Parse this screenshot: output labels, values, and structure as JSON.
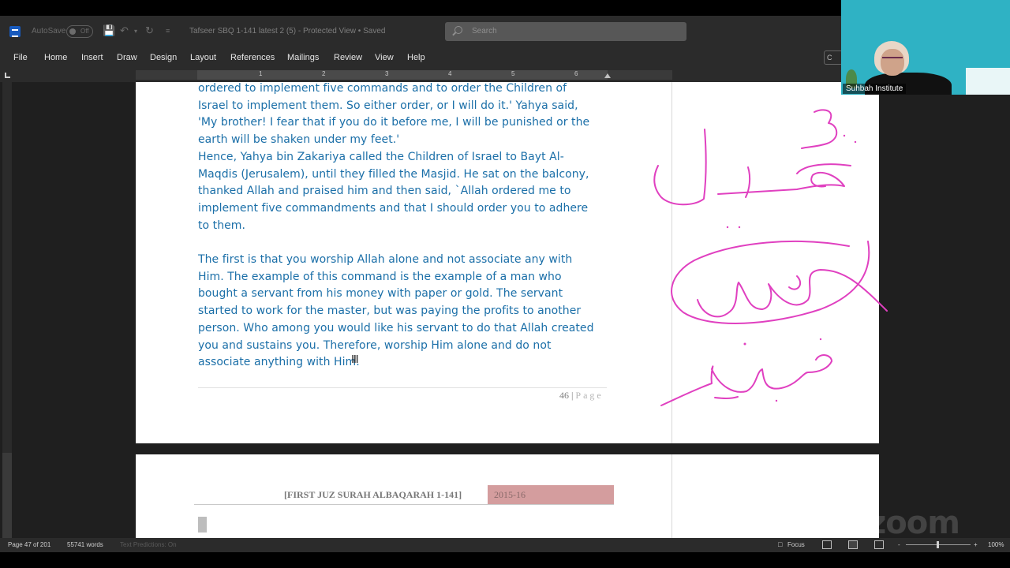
{
  "titlebar": {
    "autosave_label": "AutoSave",
    "autosave_state": "Off",
    "document_title": "Tafseer SBQ 1-141 latest 2 (5)  -  Protected View • Saved",
    "search_placeholder": "Search"
  },
  "menu": {
    "file": "File",
    "home": "Home",
    "insert": "Insert",
    "draw": "Draw",
    "design": "Design",
    "layout": "Layout",
    "references": "References",
    "mailings": "Mailings",
    "review": "Review",
    "view": "View",
    "help": "Help",
    "comments": "C"
  },
  "ruler": {
    "numbers": [
      "1",
      "2",
      "3",
      "4",
      "5",
      "6"
    ]
  },
  "document": {
    "paragraph1": [
      "ordered to implement five commands and to order the Children of",
      "Israel to implement them. So either order, or I will do it.' Yahya said,",
      "'My brother! I fear that if you do it before me, I will be punished or the",
      "earth will be shaken under my feet.'",
      "Hence, Yahya bin Zakariya called the Children of Israel to Bayt Al-",
      "Maqdis (Jerusalem), until they filled the Masjid. He sat on the balcony,",
      "thanked Allah and praised him and then said, `Allah ordered me to",
      "implement five commandments and that I should order you to adhere",
      "to them."
    ],
    "paragraph2": [
      " The first is that you worship Allah alone and not associate any with",
      "Him. The example of this command is the example of a man who",
      "bought a servant from his money with paper or gold. The servant",
      "started to work for the master, but was paying the profits to another",
      "person. Who among you would like his servant to do that Allah created",
      "you and sustains you. Therefore, worship Him alone and do not",
      "associate anything with Him."
    ],
    "page_number": "46",
    "page_separator": " | ",
    "page_label": "Page",
    "next_header_title": "[FIRST JUZ SURAH ALBAQARAH 1-141]",
    "next_header_year": "2015-16"
  },
  "statusbar": {
    "page_info": "Page 47 of 201",
    "word_count": "55741 words",
    "text_predictions": "Text Predictions: On",
    "focus": "Focus",
    "zoom_minus": "-",
    "zoom_plus": "+",
    "zoom_level": "100%"
  },
  "video": {
    "participant_name": "Suhbah Institute",
    "watermark": "zoom"
  },
  "colors": {
    "body_text": "#1b6fa8",
    "ink": "#e040c0",
    "header_year_bg": "#d49d9e"
  }
}
